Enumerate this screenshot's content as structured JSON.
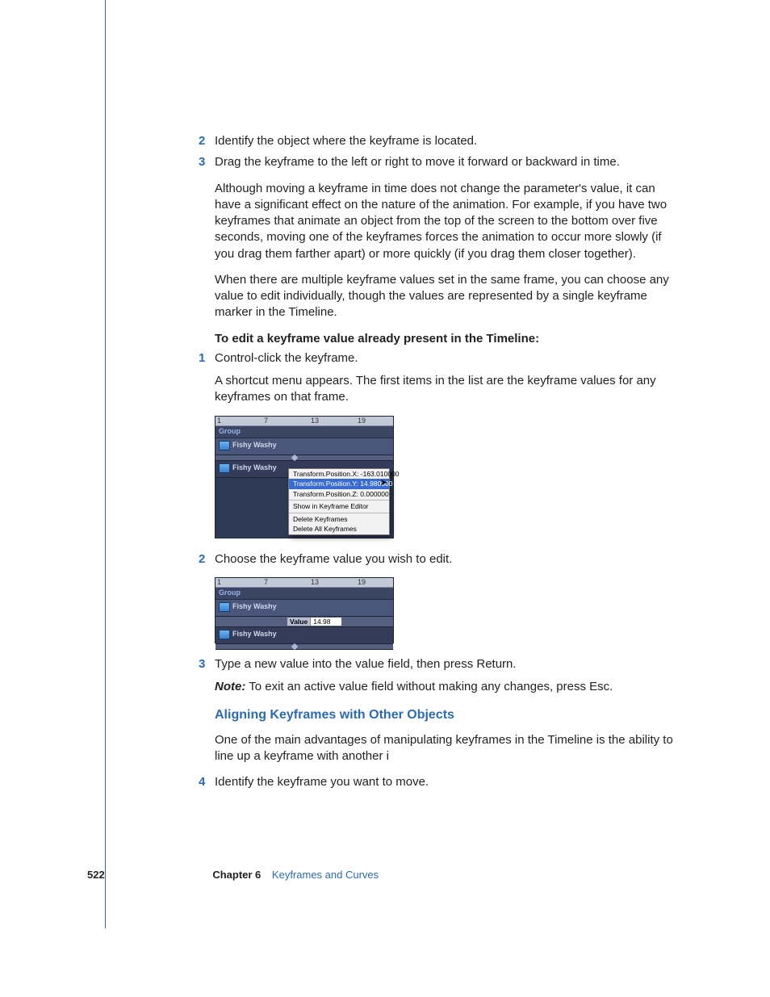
{
  "steps_top": {
    "n2": "2",
    "t2": "Identify the object where the keyframe is located.",
    "n3": "3",
    "t3": "Drag the keyframe to the left or right to move it forward or backward in time."
  },
  "para1": "Although moving a keyframe in time does not change the parameter's value, it can have a significant effect on the nature of the animation. For example, if you have two keyframes that animate an object from the top of the screen to the bottom over five seconds, moving one of the keyframes forces the animation to occur more slowly (if you drag them farther apart) or more quickly (if you drag them closer together).",
  "para2": "When there are multiple keyframe values set in the same frame, you can choose any value to edit individually, though the values are represented by a single keyframe marker in the Timeline.",
  "heading_bold": "To edit a keyframe value already present in the Timeline:",
  "edit_steps": {
    "n1": "1",
    "t1": "Control-click the keyframe.",
    "p1": "A shortcut menu appears. The first items in the list are the keyframe values for any keyframes on that frame.",
    "n2": "2",
    "t2": "Choose the keyframe value you wish to edit.",
    "n3": "3",
    "t3": "Type a new value into the value field, then press Return.",
    "note_label": "Note:",
    "note_body": "  To exit an active value field without making any changes, press Esc."
  },
  "h3_align": "Aligning Keyframes with Other Objects",
  "para_align": "One of the main advantages of manipulating keyframes in the Timeline is the ability to line up a keyframe with another i",
  "step4": {
    "n4": "4",
    "t4": "Identify the keyframe you want to move."
  },
  "footer": {
    "page": "522",
    "chapter": "Chapter 6",
    "title": "Keyframes and Curves"
  },
  "shot1": {
    "ruler": [
      "1",
      "7",
      "13",
      "19"
    ],
    "group": "Group",
    "track": "Fishy Washy",
    "menu": {
      "items": [
        "Transform.Position.X: -163.010000",
        "Transform.Position.Y: 14.980000",
        "Transform.Position.Z: 0.000000",
        "Show in Keyframe Editor",
        "Delete Keyframes",
        "Delete All Keyframes"
      ],
      "selected_index": 1
    }
  },
  "shot2": {
    "ruler": [
      "1",
      "7",
      "13",
      "19"
    ],
    "group": "Group",
    "track": "Fishy Washy",
    "value_label": "Value",
    "value_field": "14.98"
  }
}
